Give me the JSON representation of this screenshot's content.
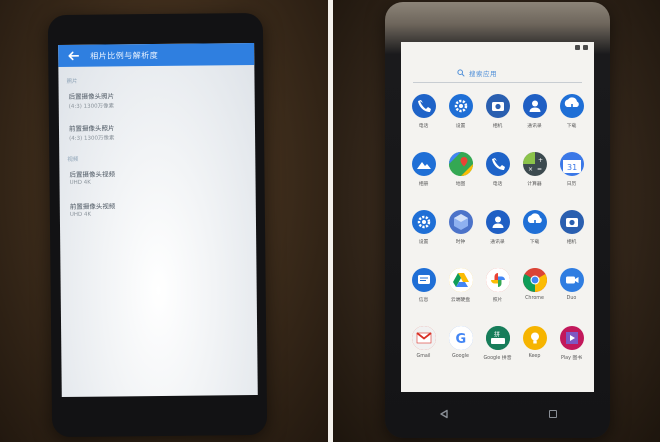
{
  "left_phone": {
    "appbar_title": "相片比例与解析度",
    "sections": [
      {
        "header": "照片",
        "items": [
          {
            "title": "后置摄像头照片",
            "subtitle": "(4:3) 1300万像素"
          },
          {
            "title": "前置摄像头照片",
            "subtitle": "(4:3) 1300万像素"
          }
        ]
      },
      {
        "header": "视频",
        "items": [
          {
            "title": "后置摄像头视频",
            "subtitle": "UHD 4K"
          },
          {
            "title": "前置摄像头视频",
            "subtitle": "UHD 4K"
          }
        ]
      }
    ]
  },
  "right_phone": {
    "search_text": "搜索应用",
    "rows": [
      [
        {
          "label": "电话",
          "icon": "phone-icon",
          "color": "#1e63c8"
        },
        {
          "label": "设置",
          "icon": "settings-gear-icon",
          "color": "#1f6fd6"
        },
        {
          "label": "相机",
          "icon": "camera-icon",
          "color": "#2a5fb0"
        },
        {
          "label": "通讯录",
          "icon": "contacts-icon",
          "color": "#1f5fc4"
        },
        {
          "label": "下载",
          "icon": "download-icon",
          "color": "#1f6fd6"
        }
      ],
      [
        {
          "label": "相册",
          "icon": "photos-icon",
          "color": "#1f6fd6"
        },
        {
          "label": "地图",
          "icon": "maps-icon",
          "color": "#34a853"
        },
        {
          "label": "电话",
          "icon": "phone-icon",
          "color": "#1e63c8"
        },
        {
          "label": "计算器",
          "icon": "calculator-icon",
          "color": "#3c4a4f"
        },
        {
          "label": "日历",
          "icon": "calendar-icon",
          "color": "#3b78e7"
        }
      ],
      [
        {
          "label": "设置",
          "icon": "settings-gear-icon",
          "color": "#1f6fd6"
        },
        {
          "label": "时钟",
          "icon": "clock-icon",
          "color": "#4c73c9"
        },
        {
          "label": "通讯录",
          "icon": "contacts-icon",
          "color": "#1f5fc4"
        },
        {
          "label": "下载",
          "icon": "download-icon",
          "color": "#1f6fd6"
        },
        {
          "label": "相机",
          "icon": "camera-icon",
          "color": "#2a5fb0"
        }
      ],
      [
        {
          "label": "信息",
          "icon": "messages-icon",
          "color": "#1f6fd6"
        },
        {
          "label": "云端硬盘",
          "icon": "drive-icon",
          "color": "#fbbc04"
        },
        {
          "label": "照片",
          "icon": "google-photos-icon",
          "color": "#ea4335"
        },
        {
          "label": "Chrome",
          "icon": "chrome-icon",
          "color": "#db4437"
        },
        {
          "label": "Duo",
          "icon": "duo-icon",
          "color": "#2f7de1"
        }
      ],
      [
        {
          "label": "Gmail",
          "icon": "gmail-icon",
          "color": "#d93025"
        },
        {
          "label": "Google",
          "icon": "google-icon",
          "color": "#4285f4"
        },
        {
          "label": "Google 拼音",
          "icon": "pinyin-keyboard-icon",
          "color": "#177d5a"
        },
        {
          "label": "Keep",
          "icon": "keep-icon",
          "color": "#f6b400"
        },
        {
          "label": "Play 图书",
          "icon": "play-books-icon",
          "color": "#c2185b"
        }
      ]
    ]
  }
}
